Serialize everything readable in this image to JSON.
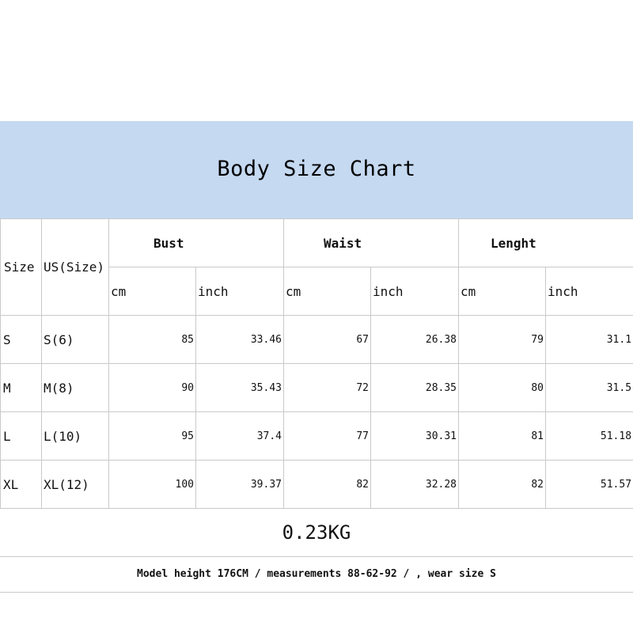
{
  "title": "Body Size Chart",
  "headers": {
    "size": "Size",
    "us_size": "US(Size)",
    "groups": [
      "Bust",
      "Waist",
      "Lenght"
    ],
    "units": [
      "cm",
      "inch",
      "cm",
      "inch",
      "cm",
      "inch"
    ]
  },
  "rows": [
    {
      "size": "S",
      "us": "S(6)",
      "bust_cm": "85",
      "bust_inch": "33.46",
      "waist_cm": "67",
      "waist_inch": "26.38",
      "length_cm": "79",
      "length_inch": "31.1"
    },
    {
      "size": "M",
      "us": "M(8)",
      "bust_cm": "90",
      "bust_inch": "35.43",
      "waist_cm": "72",
      "waist_inch": "28.35",
      "length_cm": "80",
      "length_inch": "31.5"
    },
    {
      "size": "L",
      "us": "L(10)",
      "bust_cm": "95",
      "bust_inch": "37.4",
      "waist_cm": "77",
      "waist_inch": "30.31",
      "length_cm": "81",
      "length_inch": "51.18"
    },
    {
      "size": "XL",
      "us": "XL(12)",
      "bust_cm": "100",
      "bust_inch": "39.37",
      "waist_cm": "82",
      "waist_inch": "32.28",
      "length_cm": "82",
      "length_inch": "51.57"
    }
  ],
  "weight": "0.23KG",
  "note": "Model height 176CM / measurements 88-62-92 / , wear size S"
}
